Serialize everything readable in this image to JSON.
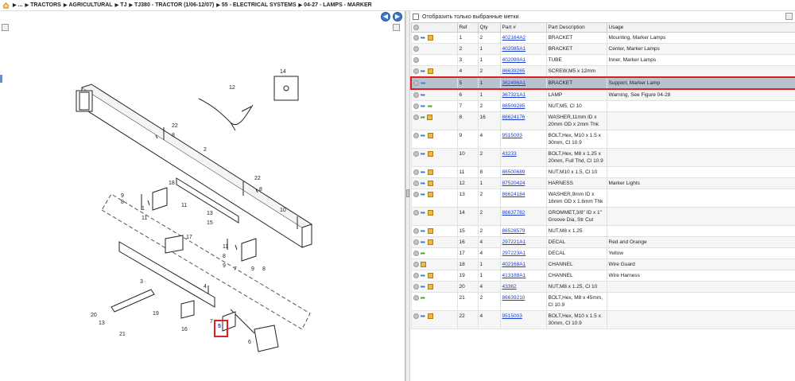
{
  "breadcrumb": {
    "items": [
      "...",
      "TRACTORS",
      "AGRICULTURAL",
      "TJ",
      "TJ380 - TRACTOR (1/06-12/07)",
      "55 - ELECTRICAL SYSTEMS",
      "04-27 - LAMPS - MARKER"
    ]
  },
  "filter": {
    "label": "Отобразить только выбранные метки"
  },
  "table": {
    "headers": [
      "Ref",
      "Qty",
      "Part #",
      "Part Description",
      "Usage"
    ],
    "rows": [
      {
        "ref": "1",
        "qty": "2",
        "part": "402164A2",
        "desc": "BRACKET",
        "usage": "Mounting, Marker Lamps",
        "icons": [
          "grey",
          "arrow",
          "box"
        ]
      },
      {
        "ref": "2",
        "qty": "1",
        "part": "402085A1",
        "desc": "BRACKET",
        "usage": "Center, Marker Lamps",
        "icons": [
          "grey"
        ]
      },
      {
        "ref": "3",
        "qty": "1",
        "part": "402090A1",
        "desc": "TUBE",
        "usage": "Inner, Marker Lamps",
        "icons": [
          "grey"
        ]
      },
      {
        "ref": "4",
        "qty": "2",
        "part": "86639265",
        "desc": "SCREW,M5 x 12mm",
        "usage": "",
        "icons": [
          "grey",
          "arrow",
          "box"
        ]
      },
      {
        "ref": "5",
        "qty": "1",
        "part": "362496A1",
        "desc": "BRACKET",
        "usage": "Support, Marker Lamp",
        "icons": [
          "grey",
          "arrow"
        ],
        "selected": true
      },
      {
        "ref": "6",
        "qty": "1",
        "part": "367321A1",
        "desc": "LAMP",
        "usage": "Warning, See Figure 04-28",
        "icons": [
          "grey",
          "arrow"
        ]
      },
      {
        "ref": "7",
        "qty": "2",
        "part": "86509285",
        "desc": "NUT,M5, Cl 10",
        "usage": "",
        "icons": [
          "grey",
          "arrow",
          "green"
        ]
      },
      {
        "ref": "8",
        "qty": "16",
        "part": "86624176",
        "desc": "WASHER,11mm ID x 20mm OD x 2mm Thk",
        "usage": "",
        "icons": [
          "grey",
          "green",
          "box"
        ]
      },
      {
        "ref": "9",
        "qty": "4",
        "part": "9515003",
        "desc": "BOLT,Hex, M10 x 1.5 x 30mm, Cl 10.9",
        "usage": "",
        "icons": [
          "grey",
          "arrow",
          "box"
        ]
      },
      {
        "ref": "10",
        "qty": "2",
        "part": "43233",
        "desc": "BOLT,Hex, M8 x 1.25 x 20mm, Full Thd, Cl 10.9",
        "usage": "",
        "icons": [
          "grey",
          "arrow",
          "box"
        ]
      },
      {
        "ref": "11",
        "qty": "8",
        "part": "86500689",
        "desc": "NUT,M10 x 1.5, Cl 10",
        "usage": "",
        "icons": [
          "grey",
          "arrow",
          "box"
        ]
      },
      {
        "ref": "12",
        "qty": "1",
        "part": "87520424",
        "desc": "HARNESS",
        "usage": "Marker Lights",
        "icons": [
          "grey",
          "arrow",
          "box"
        ]
      },
      {
        "ref": "13",
        "qty": "2",
        "part": "86624184",
        "desc": "WASHER,9mm ID x 16mm OD x 1.6mm Thk",
        "usage": "",
        "icons": [
          "grey",
          "arrow",
          "box"
        ]
      },
      {
        "ref": "14",
        "qty": "2",
        "part": "86637782",
        "desc": "GROMMET,3/8\" ID x 1\" Groove Dia, Str Cut",
        "usage": "",
        "icons": [
          "grey",
          "arrow",
          "box"
        ]
      },
      {
        "ref": "15",
        "qty": "2",
        "part": "86528579",
        "desc": "NUT,M8 x 1.25",
        "usage": "",
        "icons": [
          "grey",
          "arrow",
          "box"
        ]
      },
      {
        "ref": "16",
        "qty": "4",
        "part": "297221A1",
        "desc": "DECAL",
        "usage": "Red and Orange",
        "icons": [
          "grey",
          "arrow",
          "box"
        ]
      },
      {
        "ref": "17",
        "qty": "4",
        "part": "297223A1",
        "desc": "DECAL",
        "usage": "Yellow",
        "icons": [
          "grey",
          "green"
        ]
      },
      {
        "ref": "18",
        "qty": "1",
        "part": "402168A1",
        "desc": "CHANNEL",
        "usage": "Wire Guard",
        "icons": [
          "grey",
          "box"
        ]
      },
      {
        "ref": "19",
        "qty": "1",
        "part": "413188A1",
        "desc": "CHANNEL",
        "usage": "Wire Harness",
        "icons": [
          "grey",
          "arrow",
          "box"
        ]
      },
      {
        "ref": "20",
        "qty": "4",
        "part": "43362",
        "desc": "NUT,M8 x 1.25, Cl 10",
        "usage": "",
        "icons": [
          "grey",
          "arrow",
          "box"
        ]
      },
      {
        "ref": "21",
        "qty": "2",
        "part": "86639210",
        "desc": "BOLT,Hex, M8 x 45mm, Cl 10.9",
        "usage": "",
        "icons": [
          "grey",
          "green"
        ]
      },
      {
        "ref": "22",
        "qty": "4",
        "part": "9515003",
        "desc": "BOLT,Hex, M10 x 1.5 x 30mm, Cl 10.9",
        "usage": "",
        "icons": [
          "grey",
          "arrow",
          "box"
        ]
      }
    ]
  },
  "diagram": {
    "callouts": [
      "14",
      "12",
      "22",
      "8",
      "2",
      "18",
      "9",
      "8",
      "1",
      "11",
      "10",
      "13",
      "15",
      "22",
      "8",
      "17",
      "11",
      "8",
      "9",
      "7",
      "3",
      "4",
      "20",
      "13",
      "19",
      "21",
      "16",
      "5",
      "7",
      "6",
      "11",
      "8",
      "9"
    ],
    "selected_callout": "5"
  }
}
